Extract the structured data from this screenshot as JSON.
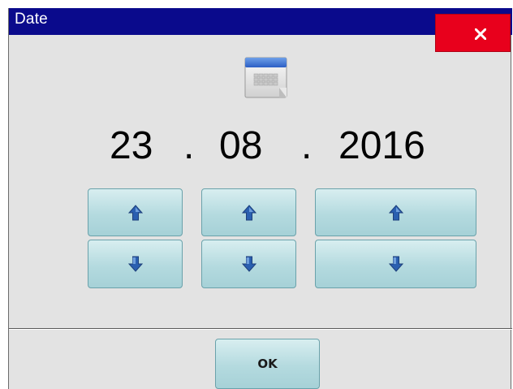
{
  "window": {
    "title": "Date"
  },
  "date": {
    "day": "23",
    "separator1": ".",
    "month": "08",
    "separator2": ".",
    "year": "2016"
  },
  "buttons": {
    "ok_label": "OK"
  },
  "icons": {
    "close": "close-icon",
    "calendar": "calendar-icon",
    "up": "arrow-up-icon",
    "down": "arrow-down-icon"
  },
  "colors": {
    "titlebar": "#0a0a8c",
    "close_button": "#e8001c",
    "dialog_background": "#e3e3e3",
    "button_face": "#b4dadf",
    "arrow": "#2a5fb0"
  }
}
